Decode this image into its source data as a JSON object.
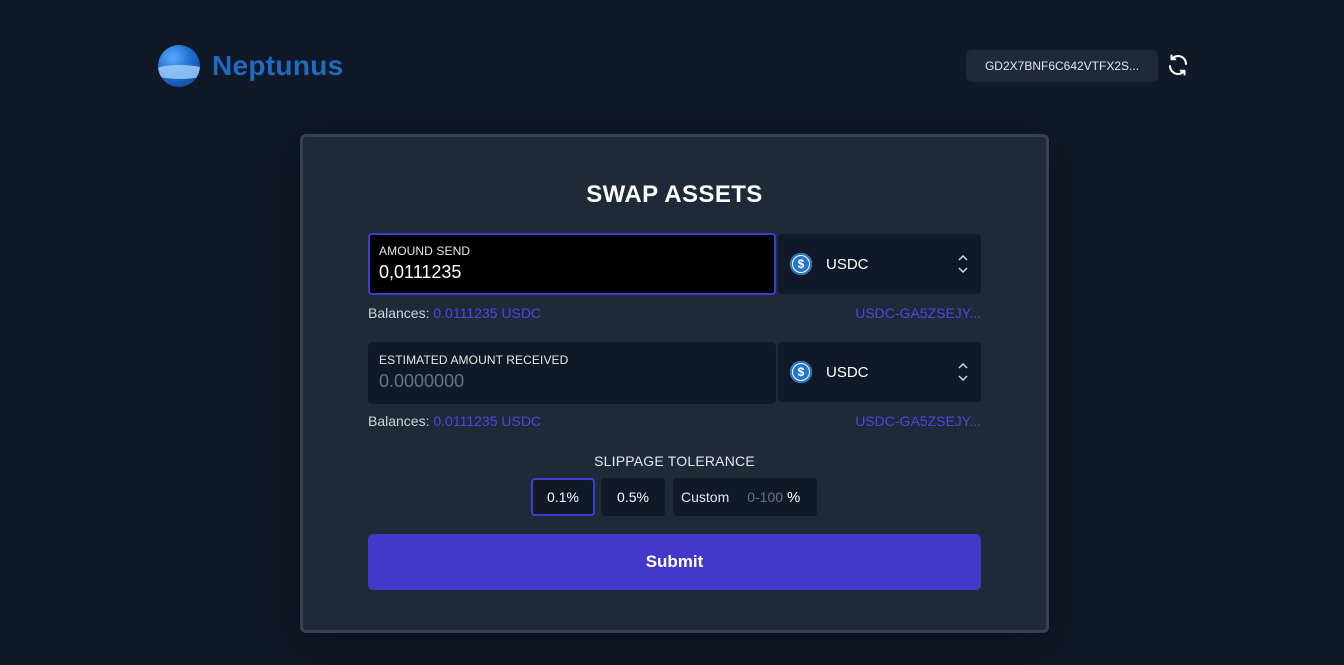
{
  "brand": {
    "name": "Neptunus"
  },
  "wallet": {
    "address": "GD2X7BNF6C642VTFX2S..."
  },
  "swap": {
    "title": "SWAP ASSETS",
    "send": {
      "label": "AMOUND SEND",
      "value": "0,0111235",
      "token": "USDC",
      "balance_label": "Balances:",
      "balance_value": "0.0111235 USDC",
      "asset_id": "USDC-GA5ZSEJY..."
    },
    "receive": {
      "label": "ESTIMATED AMOUNT RECEIVED",
      "placeholder": "0.0000000",
      "token": "USDC",
      "balance_label": "Balances:",
      "balance_value": "0.0111235 USDC",
      "asset_id": "USDC-GA5ZSEJY..."
    },
    "slippage": {
      "title": "SLIPPAGE TOLERANCE",
      "options": [
        "0.1%",
        "0.5%"
      ],
      "selected": "0.1%",
      "custom_label": "Custom",
      "custom_placeholder": "0-100",
      "custom_suffix": "%"
    },
    "submit_label": "Submit"
  },
  "colors": {
    "background": "#111827",
    "card": "#1f2937",
    "accent": "#4338ca",
    "link": "#4f46e5",
    "usdc": "#2775ca"
  },
  "icons": {
    "logo": "neptunus-logo-icon",
    "refresh": "refresh-icon",
    "token": "usdc-icon",
    "select": "chevron-updown-icon"
  }
}
